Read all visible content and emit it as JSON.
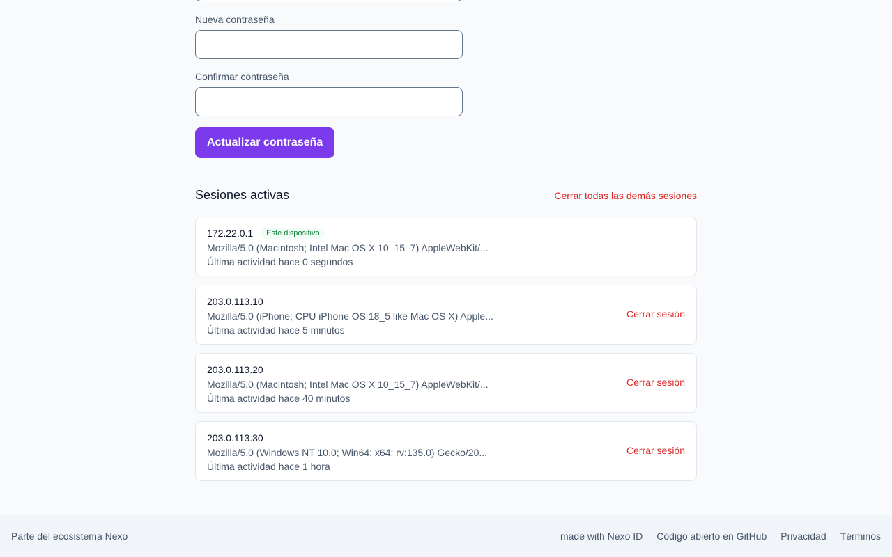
{
  "password_form": {
    "new_password_label": "Nueva contraseña",
    "new_password_value": "",
    "confirm_password_label": "Confirmar contraseña",
    "confirm_password_value": "",
    "submit_label": "Actualizar contraseña"
  },
  "sessions": {
    "title": "Sesiones activas",
    "revoke_all_label": "Cerrar todas las demás sesiones",
    "current_badge": "Este dispositivo",
    "revoke_label": "Cerrar sesión",
    "items": [
      {
        "ip": "172.22.0.1",
        "user_agent": "Mozilla/5.0 (Macintosh; Intel Mac OS X 10_15_7) AppleWebKit/...",
        "activity": "Última actividad hace 0 segundos"
      },
      {
        "ip": "203.0.113.10",
        "user_agent": "Mozilla/5.0 (iPhone; CPU iPhone OS 18_5 like Mac OS X) Apple...",
        "activity": "Última actividad hace 5 minutos"
      },
      {
        "ip": "203.0.113.20",
        "user_agent": "Mozilla/5.0 (Macintosh; Intel Mac OS X 10_15_7) AppleWebKit/...",
        "activity": "Última actividad hace 40 minutos"
      },
      {
        "ip": "203.0.113.30",
        "user_agent": "Mozilla/5.0 (Windows NT 10.0; Win64; x64; rv:135.0) Gecko/20...",
        "activity": "Última actividad hace 1 hora"
      }
    ]
  },
  "footer": {
    "left_text": "Parte del ecosistema Nexo",
    "links": [
      "made with Nexo ID",
      "Código abierto en GitHub",
      "Privacidad",
      "Términos"
    ]
  },
  "colors": {
    "accent": "#7c3aed",
    "danger": "#dc2626",
    "success": "#15803d"
  }
}
